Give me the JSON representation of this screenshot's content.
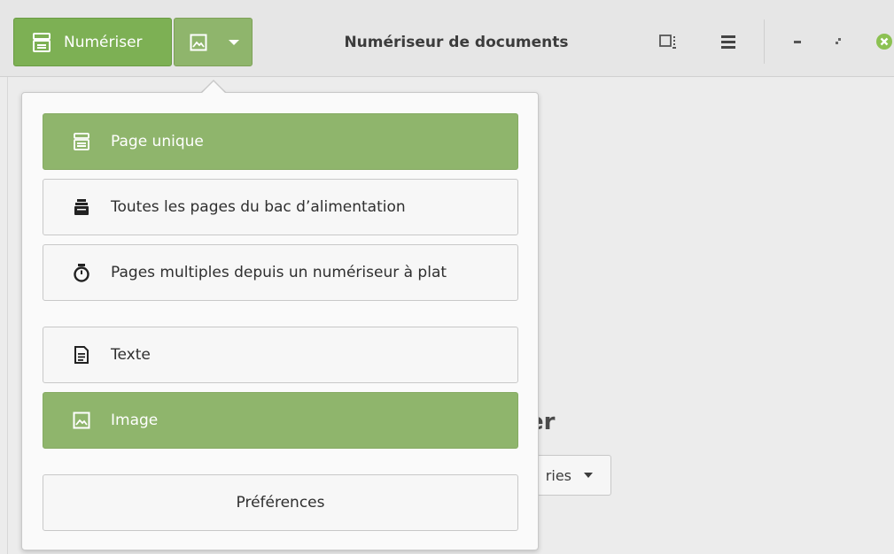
{
  "window": {
    "title": "Numériseur de documents"
  },
  "header": {
    "scan_button_label": "Numériser",
    "scan_icon": "scanner-icon",
    "type_icon": "image-icon",
    "type_dropdown_icon": "chevron-down-icon",
    "document_icon": "page-view-icon",
    "menu_icon": "hamburger-menu-icon",
    "minimize_icon": "minimize-icon",
    "maximize_icon": "maximize-icon",
    "close_icon": "close-icon"
  },
  "popover": {
    "items": [
      {
        "label": "Page unique",
        "icon": "scanner-icon",
        "active": true
      },
      {
        "label": "Toutes les pages du bac d’alimentation",
        "icon": "paper-stack-icon",
        "active": false
      },
      {
        "label": "Pages multiples depuis un numériseur à plat",
        "icon": "timer-icon",
        "active": false
      },
      {
        "label": "Texte",
        "icon": "text-document-icon",
        "active": false
      },
      {
        "label": "Image",
        "icon": "image-icon",
        "active": true
      },
      {
        "label": "Préférences",
        "icon": "",
        "active": false
      }
    ]
  },
  "background": {
    "heading_fragment": "er",
    "button_fragment": "ries"
  },
  "colors": {
    "accent_green": "#7db054",
    "active_item_green": "#8fb56c",
    "close_button": "#8cc152"
  }
}
